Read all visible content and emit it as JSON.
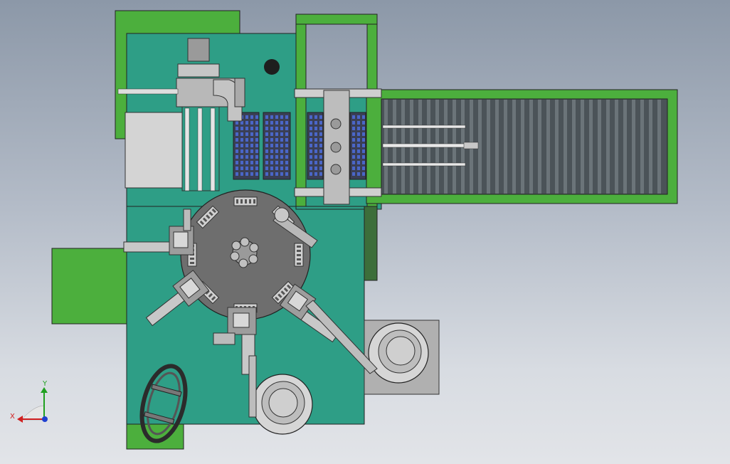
{
  "viewport": {
    "kind": "3D CAD model view (top view) of automated assembly machine",
    "background_top": "#8c98a8",
    "background_bottom": "#e2e4e8"
  },
  "colors": {
    "frame_green": "#4caf3d",
    "plate_teal": "#2e9e86",
    "steel_grey": "#8a8a8a",
    "dark_grey": "#5a5a5a",
    "tray_blue": "#3a4fa0",
    "triad_x": "#d02020",
    "triad_y": "#20a020",
    "triad_z": "#2040d0"
  },
  "triad": {
    "x_label": "X",
    "y_label": "Y"
  }
}
